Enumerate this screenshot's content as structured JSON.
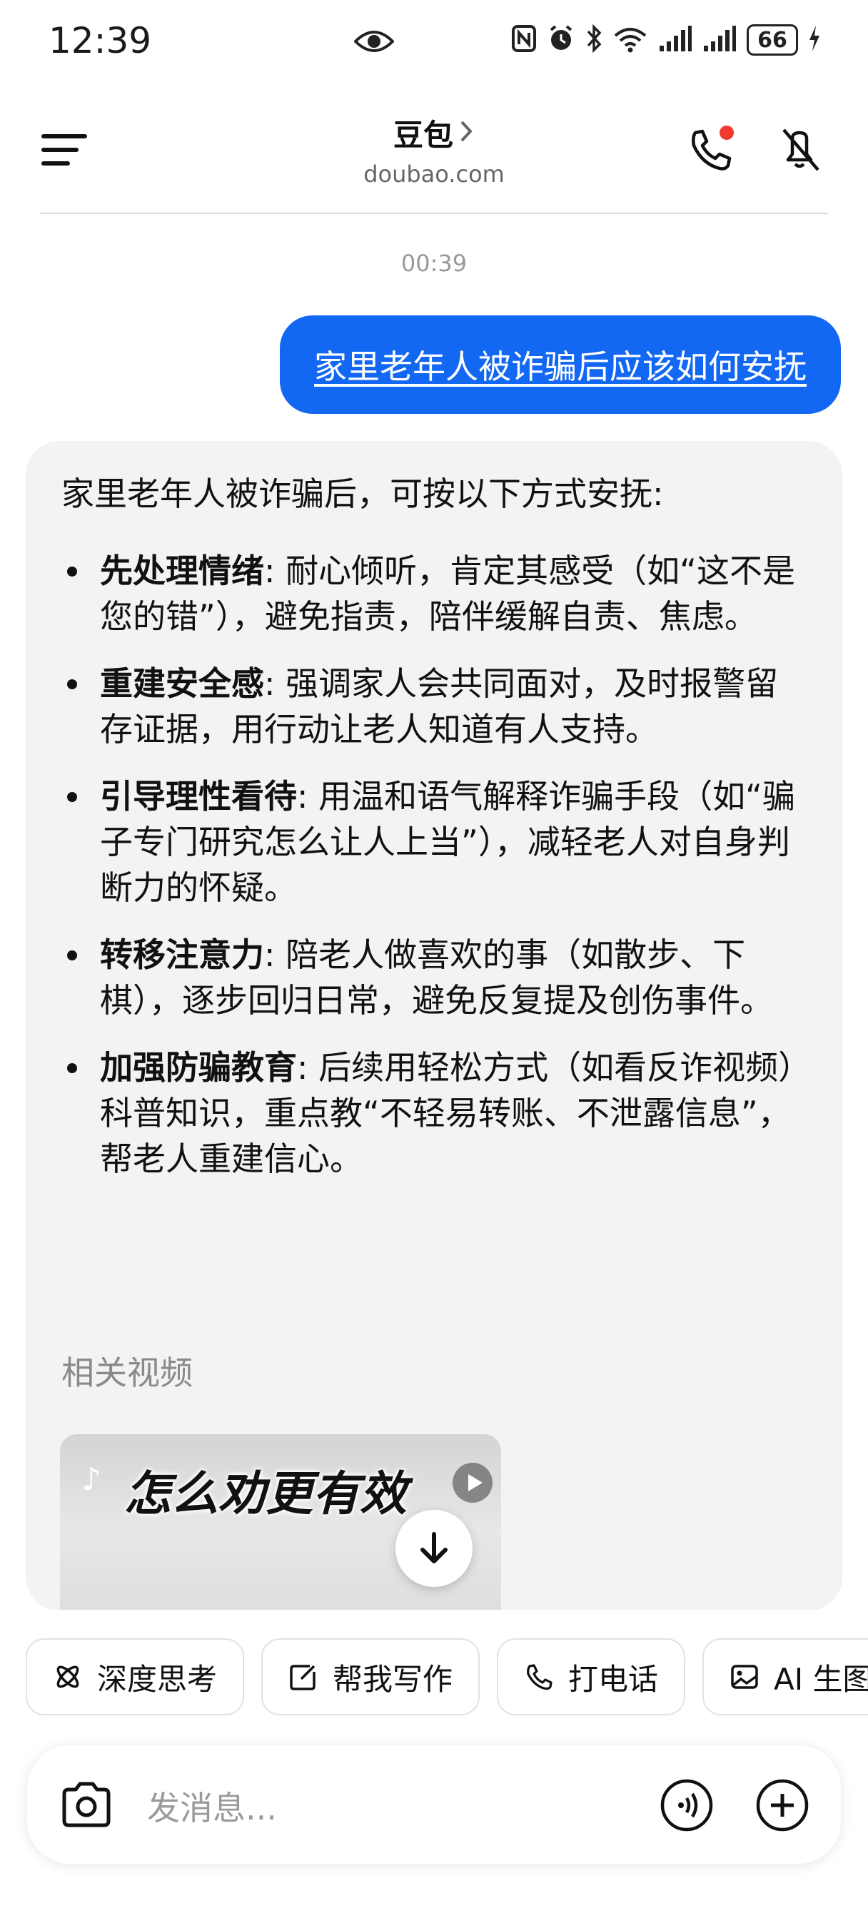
{
  "status_bar": {
    "time": "12:39",
    "battery": "66"
  },
  "header": {
    "title": "豆包",
    "subtitle": "doubao.com"
  },
  "chat": {
    "timestamp": "00:39",
    "user_message": "家里老年人被诈骗后应该如何安抚",
    "answer": {
      "intro": "家里老年人被诈骗后，可按以下方式安抚:",
      "items": [
        {
          "title": "先处理情绪",
          "text": ": 耐心倾听，肯定其感受（如“这不是您的错”），避免指责，陪伴缓解自责、焦虑。"
        },
        {
          "title": "重建安全感",
          "text": ": 强调家人会共同面对，及时报警留存证据，用行动让老人知道有人支持。"
        },
        {
          "title": "引导理性看待",
          "text": ": 用温和语气解释诈骗手段（如“骗子专门研究怎么让人上当”），减轻老人对自身判断力的怀疑。"
        },
        {
          "title": "转移注意力",
          "text": ": 陪老人做喜欢的事（如散步、下棋），逐步回归日常，避免反复提及创伤事件。"
        },
        {
          "title": "加强防骗教育",
          "text": ": 后续用轻松方式（如看反诈视频）科普知识，重点教“不轻易转账、不泄露信息”，帮老人重建信心。"
        }
      ],
      "related_label": "相关视频",
      "video_caption": "怎么劝更有效"
    }
  },
  "chips": [
    {
      "label": "深度思考",
      "icon": "atom-icon"
    },
    {
      "label": "帮我写作",
      "icon": "edit-icon"
    },
    {
      "label": "打电话",
      "icon": "phone-icon"
    },
    {
      "label": "AI 生图",
      "icon": "image-icon"
    }
  ],
  "input": {
    "placeholder": "发消息..."
  }
}
